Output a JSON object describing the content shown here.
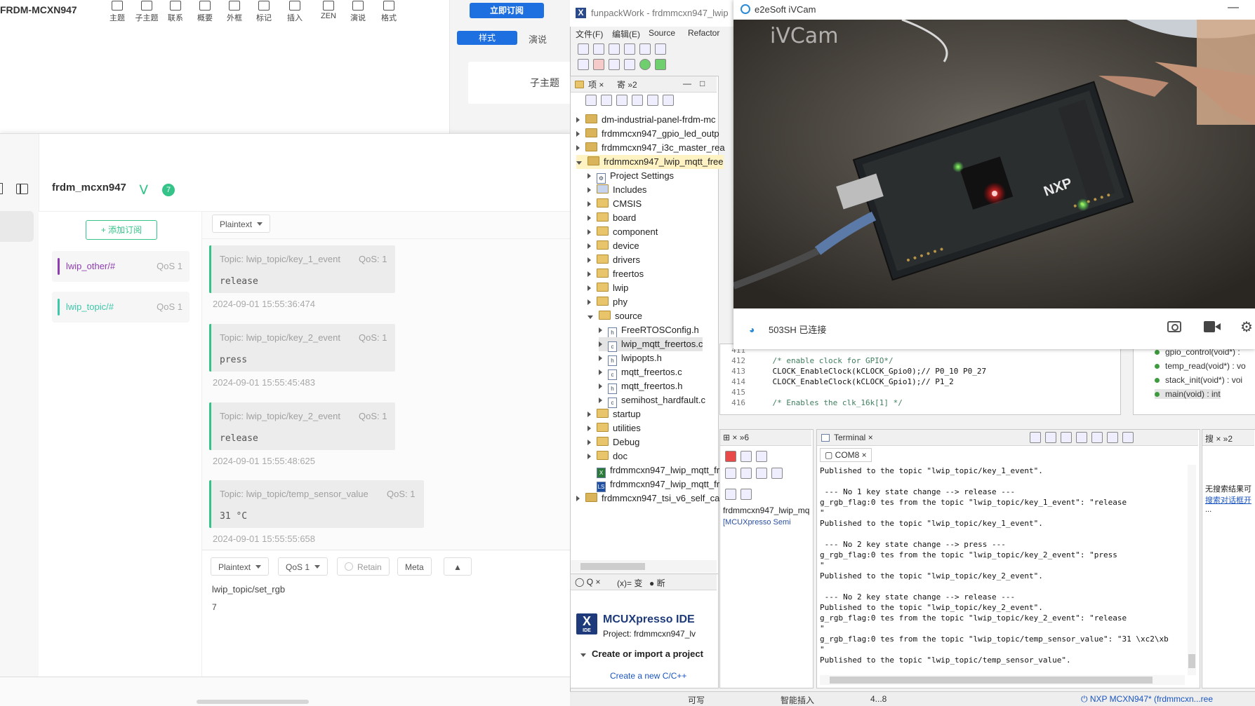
{
  "mqttx": {
    "app_title": "FRDM-MCXN947",
    "toolbar": [
      {
        "label": "主题",
        "icon": "topic-icon"
      },
      {
        "label": "子主题",
        "icon": "subtopic-icon"
      },
      {
        "label": "联系",
        "icon": "link-icon"
      },
      {
        "label": "概要",
        "icon": "summary-icon"
      },
      {
        "label": "外框",
        "icon": "frame-icon"
      },
      {
        "label": "标记",
        "icon": "star-icon"
      },
      {
        "label": "插入",
        "icon": "plus-icon"
      },
      {
        "label": "ZEN",
        "icon": "zen-icon"
      },
      {
        "label": "演说",
        "icon": "present-icon"
      },
      {
        "label": "格式",
        "icon": "format-icon"
      }
    ],
    "subscribe_now_button": "立即订阅",
    "right_tabs": [
      "样式",
      "演说"
    ],
    "right_subtopic": "子主题",
    "connection_name": "frdm_mcxn947",
    "badge_count": "7",
    "add_subscription": "+ 添加订阅",
    "subscriptions": [
      {
        "topic": "lwip_other/#",
        "qos": "QoS 1",
        "color": "#8e3db0"
      },
      {
        "topic": "lwip_topic/#",
        "qos": "QoS 1",
        "color": "#3ec7a9"
      }
    ],
    "payload_format": "Plaintext",
    "messages": [
      {
        "topic": "Topic: lwip_topic/key_1_event",
        "qos": "QoS: 1",
        "payload": "release",
        "time": "2024-09-01 15:55:36:474"
      },
      {
        "topic": "Topic: lwip_topic/key_2_event",
        "qos": "QoS: 1",
        "payload": "press",
        "time": "2024-09-01 15:55:45:483"
      },
      {
        "topic": "Topic: lwip_topic/key_2_event",
        "qos": "QoS: 1",
        "payload": "release",
        "time": "2024-09-01 15:55:48:625"
      },
      {
        "topic": "Topic: lwip_topic/temp_sensor_value",
        "qos": "QoS: 1",
        "payload": "31 °C",
        "time": "2024-09-01 15:55:55:658"
      }
    ],
    "publish": {
      "format": "Plaintext",
      "qos": "QoS 1",
      "retain": "Retain",
      "meta": "Meta",
      "topic": "lwip_topic/set_rgb",
      "payload": "7"
    }
  },
  "ide": {
    "title": "funpackWork - frdmmcxn947_lwip",
    "menu": [
      "文件(F)",
      "编辑(E)",
      "Source",
      "Refactor"
    ],
    "tree_tab_labels": [
      "项",
      "寄"
    ],
    "tree": [
      {
        "label": "dm-industrial-panel-frdm-mc",
        "type": "project",
        "depth": 0,
        "expand": "closed"
      },
      {
        "label": "frdmmcxn947_gpio_led_outp",
        "type": "project",
        "depth": 0,
        "expand": "closed"
      },
      {
        "label": "frdmmcxn947_i3c_master_rea",
        "type": "project",
        "depth": 0,
        "expand": "closed"
      },
      {
        "label": "frdmmcxn947_lwip_mqtt_free",
        "type": "project",
        "depth": 0,
        "expand": "open",
        "selected": true
      },
      {
        "label": "Project Settings",
        "type": "settings",
        "depth": 1,
        "expand": "closed"
      },
      {
        "label": "Includes",
        "type": "includes",
        "depth": 1,
        "expand": "closed"
      },
      {
        "label": "CMSIS",
        "type": "folder",
        "depth": 1,
        "expand": "closed"
      },
      {
        "label": "board",
        "type": "folder",
        "depth": 1,
        "expand": "closed"
      },
      {
        "label": "component",
        "type": "folder",
        "depth": 1,
        "expand": "closed"
      },
      {
        "label": "device",
        "type": "folder",
        "depth": 1,
        "expand": "closed"
      },
      {
        "label": "drivers",
        "type": "folder",
        "depth": 1,
        "expand": "closed"
      },
      {
        "label": "freertos",
        "type": "folder",
        "depth": 1,
        "expand": "closed"
      },
      {
        "label": "lwip",
        "type": "folder",
        "depth": 1,
        "expand": "closed"
      },
      {
        "label": "phy",
        "type": "folder",
        "depth": 1,
        "expand": "closed"
      },
      {
        "label": "source",
        "type": "folder",
        "depth": 1,
        "expand": "open"
      },
      {
        "label": "FreeRTOSConfig.h",
        "type": "h",
        "depth": 2,
        "expand": "closed"
      },
      {
        "label": "lwip_mqtt_freertos.c",
        "type": "c",
        "depth": 2,
        "expand": "closed",
        "highlight": true
      },
      {
        "label": "lwipopts.h",
        "type": "h",
        "depth": 2,
        "expand": "closed"
      },
      {
        "label": "mqtt_freertos.c",
        "type": "c",
        "depth": 2,
        "expand": "closed"
      },
      {
        "label": "mqtt_freertos.h",
        "type": "h",
        "depth": 2,
        "expand": "closed"
      },
      {
        "label": "semihost_hardfault.c",
        "type": "c",
        "depth": 2,
        "expand": "closed"
      },
      {
        "label": "startup",
        "type": "folder",
        "depth": 1,
        "expand": "closed"
      },
      {
        "label": "utilities",
        "type": "folder",
        "depth": 1,
        "expand": "closed"
      },
      {
        "label": "Debug",
        "type": "folder",
        "depth": 1,
        "expand": "closed"
      },
      {
        "label": "doc",
        "type": "folder",
        "depth": 1,
        "expand": "closed"
      },
      {
        "label": "frdmmcxn947_lwip_mqtt_fr",
        "type": "x",
        "depth": 1,
        "expand": "none"
      },
      {
        "label": "frdmmcxn947_lwip_mqtt_fr",
        "type": "ls",
        "depth": 1,
        "expand": "none"
      },
      {
        "label": "frdmmcxn947_tsi_v6_self_cap",
        "type": "project",
        "depth": 0,
        "expand": "closed"
      }
    ],
    "quickstart_tabs": [
      "Q",
      "变",
      "断"
    ],
    "quickstart_title": "MCUXpresso IDE",
    "quickstart_project": "Project: frdmmcxn947_lv",
    "quickstart_section": "Create or import a project",
    "quickstart_link": "Create a new C/C++",
    "code_lines": [
      {
        "n": "411",
        "t": ""
      },
      {
        "n": "412",
        "t": "    /* enable clock for GPIO*/"
      },
      {
        "n": "413",
        "t": "    CLOCK_EnableClock(kCLOCK_Gpio0);// P0_10 P0_27"
      },
      {
        "n": "414",
        "t": "    CLOCK_EnableClock(kCLOCK_Gpio1);// P1_2"
      },
      {
        "n": "415",
        "t": ""
      },
      {
        "n": "416",
        "t": "    /* Enables the clk_16k[1] */"
      }
    ],
    "outline": [
      "gpio_control(void*) :",
      "temp_read(void*) : vo",
      "stack_init(void*) : voi",
      "main(void) : int"
    ],
    "debug_label": "frdmmcxn947_lwip_mq",
    "debug_item": "[MCUXpresso Semi",
    "terminal_tab": "Terminal",
    "com_tab": "COM8",
    "terminal_lines": [
      "Published to the topic \"lwip_topic/key_1_event\".",
      "",
      " --- No 1 key state change --> release ---",
      "g_rgb_flag:0 tes from the topic \"lwip_topic/key_1_event\": \"release",
      "\"",
      "Published to the topic \"lwip_topic/key_1_event\".",
      "",
      " --- No 2 key state change --> press ---",
      "g_rgb_flag:0 tes from the topic \"lwip_topic/key_2_event\": \"press",
      "\"",
      "Published to the topic \"lwip_topic/key_2_event\".",
      "",
      " --- No 2 key state change --> release ---",
      "Published to the topic \"lwip_topic/key_2_event\".",
      "g_rgb_flag:0 tes from the topic \"lwip_topic/key_2_event\": \"release",
      "\"",
      "g_rgb_flag:0 tes from the topic \"lwip_topic/temp_sensor_value\": \"31 \\xc2\\xb",
      "\"",
      "Published to the topic \"lwip_topic/temp_sensor_value\"."
    ],
    "search_text1": "无搜索结果可",
    "search_text2": "搜索对话框开",
    "search_text3": "...",
    "status": [
      "可写",
      "智能插入",
      "4...8",
      "NXP MCXN947* (frdmmcxn...ree"
    ]
  },
  "ivcam": {
    "title": "e2eSoft iVCam",
    "watermark": "iVCam",
    "wifi_status": "503SH 已连接",
    "board_text": "NXP"
  }
}
